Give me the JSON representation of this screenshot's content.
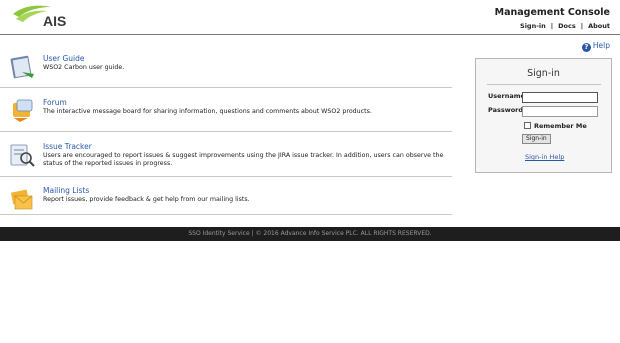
{
  "header": {
    "logo_text": "AIS",
    "console_title": "Management Console",
    "links": [
      "Sign-in",
      "Docs",
      "About"
    ]
  },
  "help": {
    "label": "Help"
  },
  "resources": [
    {
      "title": "User Guide",
      "description": "WSO2 Carbon user guide.",
      "icon": "book-icon"
    },
    {
      "title": "Forum",
      "description": "The interactive message board for sharing information, questions and comments about WSO2 products.",
      "icon": "forum-icon"
    },
    {
      "title": "Issue Tracker",
      "description": "Users are encouraged to report issues & suggest improvements using the JIRA issue tracker. In addition, users can observe the status of the reported issues in progress.",
      "icon": "issue-tracker-icon"
    },
    {
      "title": "Mailing Lists",
      "description": "Report issues, provide feedback & get help from our mailing lists.",
      "icon": "mail-icon"
    }
  ],
  "signin": {
    "title": "Sign-in",
    "username_label": "Username",
    "password_label": "Password",
    "username_value": "",
    "password_value": "",
    "remember_label": "Remember Me",
    "remember_checked": false,
    "button_label": "Sign-in",
    "help_link": "Sign-in Help"
  },
  "footer": {
    "text": "SSO Identity Service | © 2016 Advance Info Service PLC. ALL RIGHTS RESERVED."
  },
  "colors": {
    "link": "#2a58a8",
    "brand_green": "#8dc63f",
    "footer_bg": "#1e1e1e"
  }
}
